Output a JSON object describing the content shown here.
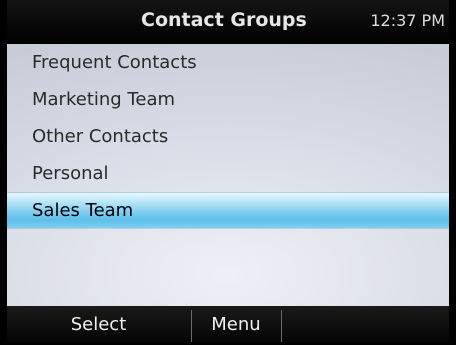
{
  "header": {
    "title": "Contact Groups",
    "time": "12:37 PM"
  },
  "groups": [
    {
      "label": "Frequent Contacts",
      "selected": false
    },
    {
      "label": "Marketing Team",
      "selected": false
    },
    {
      "label": "Other Contacts",
      "selected": false
    },
    {
      "label": "Personal",
      "selected": false
    },
    {
      "label": "Sales Team",
      "selected": true
    }
  ],
  "softkeys": {
    "left_label": "Select",
    "middle_label": "Menu",
    "right_label": ""
  },
  "colors": {
    "header_bg": "#000000",
    "selection_highlight": "#5ebfeb",
    "list_bg": "#d8dce6"
  }
}
